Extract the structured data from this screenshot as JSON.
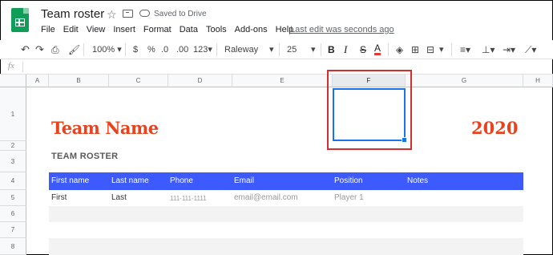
{
  "header": {
    "title": "Team roster",
    "saved": "Saved to Drive",
    "menu": [
      "File",
      "Edit",
      "View",
      "Insert",
      "Format",
      "Data",
      "Tools",
      "Add-ons",
      "Help"
    ],
    "last_edit": "Last edit was seconds ago"
  },
  "toolbar": {
    "zoom": "100%",
    "currency": "$",
    "percent": "%",
    "dec_less": ".0",
    "dec_more": ".00",
    "format_more": "123",
    "font": "Raleway",
    "font_size": "25",
    "bold": "B",
    "italic": "I",
    "strike": "S",
    "text_color": "A"
  },
  "formula_bar": {
    "fx": "fx"
  },
  "columns": [
    "A",
    "B",
    "C",
    "D",
    "E",
    "F",
    "G",
    "H"
  ],
  "rows": [
    "1",
    "2",
    "3",
    "4",
    "5",
    "6",
    "7",
    "8"
  ],
  "sheet": {
    "team_name": "Team Name",
    "year": "2020",
    "roster_label": "TEAM ROSTER",
    "table_headers": [
      "First name",
      "Last name",
      "Phone",
      "Email",
      "Position",
      "Notes"
    ],
    "row1": [
      "First",
      "Last",
      "111-111-1111",
      "email@email.com",
      "Player 1"
    ]
  },
  "colors": {
    "accent": "#3d5afe",
    "title": "#e8431f",
    "selection": "#1a73e8",
    "highlight": "#d32f2f"
  }
}
